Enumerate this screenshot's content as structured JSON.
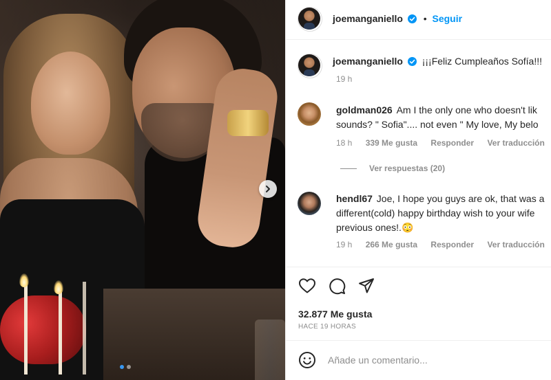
{
  "post": {
    "author": "joemanganiello",
    "separator": "•",
    "follow_label": "Seguir",
    "caption": "¡¡¡Feliz Cumpleaños Sofía!!!",
    "caption_time": "19 h",
    "carousel": {
      "current_slide": 1,
      "total_slides": 2
    }
  },
  "comments": [
    {
      "username": "goldman026",
      "line1": "Am I the only one who doesn't lik",
      "line2": "sounds? \" Sofia\".... not even \" My love, My belo",
      "time": "18 h",
      "likes": "339 Me gusta",
      "reply": "Responder",
      "translate": "Ver traducción",
      "view_replies": "Ver respuestas (20)"
    },
    {
      "username": "hendl67",
      "line1": "Joe, I hope you guys are ok, that was a",
      "line2": "different(cold) happy birthday wish to your wife",
      "line3": "previous ones!.😳",
      "time": "19 h",
      "likes": "266 Me gusta",
      "reply": "Responder",
      "translate": "Ver traducción"
    }
  ],
  "actions": {
    "likes_count": "32.877 Me gusta",
    "posted_ago": "HACE 19 HORAS"
  },
  "composer": {
    "placeholder": "Añade un comentario..."
  },
  "colors": {
    "accent": "#0095f6",
    "text": "#262626",
    "muted": "#8e8e8e",
    "divider": "#efefef"
  }
}
